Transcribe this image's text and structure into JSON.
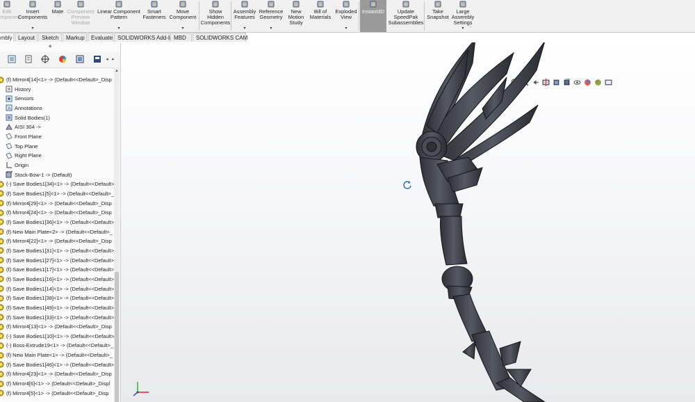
{
  "ribbon": {
    "buttons": [
      {
        "label": "Edit\nComponent",
        "icon": "edit-component-icon",
        "disabled": true
      },
      {
        "label": "Insert\nComponents",
        "icon": "insert-components-icon",
        "arrow": "▾"
      },
      {
        "label": "Mate",
        "icon": "mate-icon"
      },
      {
        "label": "Component\nPreview\nWindow",
        "icon": "component-preview-icon",
        "disabled": true
      },
      {
        "label": "Linear Component\nPattern",
        "icon": "linear-pattern-icon",
        "arrow": "▾"
      },
      {
        "label": "Smart\nFasteners",
        "icon": "smart-fasteners-icon"
      },
      {
        "label": "Move\nComponent",
        "icon": "move-component-icon",
        "arrow": "▾"
      },
      {
        "label": "Show\nHidden\nComponents",
        "icon": "show-hidden-icon"
      },
      {
        "label": "Assembly\nFeatures",
        "icon": "assembly-features-icon",
        "arrow": "▾"
      },
      {
        "label": "Reference\nGeometry",
        "icon": "reference-geometry-icon",
        "arrow": "▾"
      },
      {
        "label": "New\nMotion\nStudy",
        "icon": "motion-study-icon"
      },
      {
        "label": "Bill of\nMaterials",
        "icon": "bill-of-materials-icon"
      },
      {
        "label": "Exploded\nView",
        "icon": "exploded-view-icon",
        "arrow": "▾"
      },
      {
        "label": "Instant3D",
        "icon": "instant3d-icon",
        "active": true
      },
      {
        "label": "Update\nSpeedPak\nSubassemblies",
        "icon": "speedpak-icon"
      },
      {
        "label": "Take\nSnapshot",
        "icon": "snapshot-icon"
      },
      {
        "label": "Large\nAssembly\nSettings",
        "icon": "large-assembly-icon",
        "arrow": "▾"
      }
    ]
  },
  "tabs": [
    "Assembly",
    "Layout",
    "Sketch",
    "Markup",
    "Evaluate",
    "SOLIDWORKS Add-Ins",
    "MBD",
    "SOLIDWORKS CAM"
  ],
  "feature_tree": {
    "rows": [
      {
        "text": "(f) Mirror4[14]<1> -> (Default<<Default>_Disp",
        "icon": "component-icon"
      },
      {
        "text": "History",
        "icon": "history-icon"
      },
      {
        "text": "Sensors",
        "icon": "sensors-icon"
      },
      {
        "text": "Annotations",
        "icon": "annotations-icon"
      },
      {
        "text": "Solid Bodies(1)",
        "icon": "solid-bodies-icon"
      },
      {
        "text": "AISI 304 ->",
        "icon": "material-icon"
      },
      {
        "text": "Front Plane",
        "icon": "plane-icon"
      },
      {
        "text": "Top Plane",
        "icon": "plane-icon"
      },
      {
        "text": "Right Plane",
        "icon": "plane-icon"
      },
      {
        "text": "Origin",
        "icon": "origin-icon"
      },
      {
        "text": "Stock-Bow-1 -> (Default)",
        "icon": "part-icon"
      },
      {
        "text": "(-) Save Bodies1[34]<1> -> (Default<<Default>",
        "icon": "component-icon"
      },
      {
        "text": "(f) Save Bodies1[5]<1> -> (Default<<Default>_",
        "icon": "component-icon"
      },
      {
        "text": "(f) Mirror4[29]<1> -> (Default<<Default>_Disp",
        "icon": "component-icon"
      },
      {
        "text": "(f) Mirror4[24]<1> -> (Default<<Default>_Disp",
        "icon": "component-icon"
      },
      {
        "text": "(f) Save Bodies1[36]<1> -> (Default<<Default>",
        "icon": "component-icon"
      },
      {
        "text": "(f) New Main Plate<2> -> (Default<<Default>_",
        "icon": "component-icon"
      },
      {
        "text": "(f) Mirror4[22]<1> -> (Default<<Default>_Disp",
        "icon": "component-icon"
      },
      {
        "text": "(f) Save Bodies1[31]<1> -> (Default<<Default>",
        "icon": "component-icon"
      },
      {
        "text": "(f) Save Bodies1[27]<1> -> (Default<<Default>",
        "icon": "component-icon"
      },
      {
        "text": "(f) Save Bodies1[17]<1> -> (Default<<Default>",
        "icon": "component-icon"
      },
      {
        "text": "(f) Save Bodies1[16]<1> -> (Default<<Default>",
        "icon": "component-icon"
      },
      {
        "text": "(f) Save Bodies1[14]<1> -> (Default<<Default>",
        "icon": "component-icon"
      },
      {
        "text": "(f) Save Bodies1[38]<1> -> (Default<<Default>",
        "icon": "component-icon"
      },
      {
        "text": "(f) Save Bodies1[49]<1> -> (Default<<Default>",
        "icon": "component-icon"
      },
      {
        "text": "(f) Save Bodies1[33]<1> -> (Default<<Default>",
        "icon": "component-icon"
      },
      {
        "text": "(f) Mirror4[13]<1> -> (Default<<Default>_Disp",
        "icon": "component-icon"
      },
      {
        "text": "(-) Save Bodies1[10]<1> -> (Default<<Default>",
        "icon": "component-icon"
      },
      {
        "text": "(-) Boss-Extrude19<1> -> (Default<<Default>_",
        "icon": "component-icon"
      },
      {
        "text": "(f) New Main Plate<1> -> (Default<<Default>_",
        "icon": "component-icon"
      },
      {
        "text": "(f) Save Bodies1[46]<1> -> (Default<<Default>",
        "icon": "component-icon"
      },
      {
        "text": "(f) Mirror4[23]<1> -> (Default<<Default>_Disp",
        "icon": "component-icon"
      },
      {
        "text": "(f) Mirror4[6]<1> -> (Default<<Default>_Displ",
        "icon": "component-icon"
      },
      {
        "text": "(f) Mirror4[5]<1> -> (Default<<Default>_Disp",
        "icon": "component-icon"
      }
    ]
  },
  "heads_up_toolbar": [
    "zoom-to-fit-icon",
    "zoom-to-area-icon",
    "previous-view-icon",
    "section-view-icon",
    "view-orientation-icon",
    "display-style-icon",
    "hide-show-icon",
    "edit-appearance-icon",
    "apply-scene-icon",
    "view-settings-icon"
  ],
  "colors": {
    "model": "#3d3f47",
    "model_edge": "#15161a",
    "ribbon_bg": "#f0f0f0",
    "instant3d_active": "#9a9a9a",
    "component_icon": "#d4b21a"
  }
}
